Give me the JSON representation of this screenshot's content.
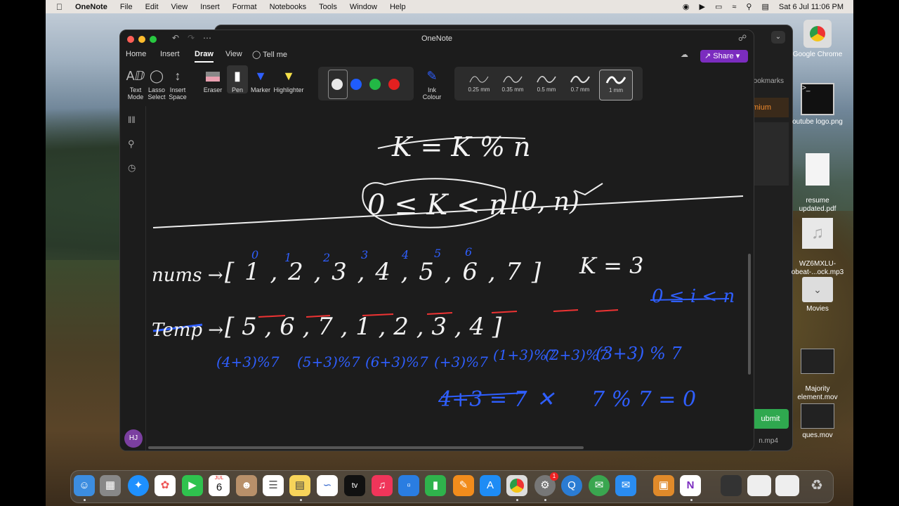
{
  "menubar": {
    "app": "OneNote",
    "items": [
      "File",
      "Edit",
      "View",
      "Insert",
      "Format",
      "Notebooks",
      "Tools",
      "Window",
      "Help"
    ],
    "datetime": "Sat 6 Jul  11:06 PM"
  },
  "window": {
    "title": "OneNote",
    "tabs": [
      "Home",
      "Insert",
      "Draw",
      "View"
    ],
    "tell_me": "Tell me",
    "share": "Share",
    "active_tab": "Draw"
  },
  "ribbon": {
    "text_mode": [
      "Text",
      "Mode"
    ],
    "lasso": [
      "Lasso",
      "Select"
    ],
    "insert_space": [
      "Insert",
      "Space"
    ],
    "eraser": "Eraser",
    "pen": "Pen",
    "marker": "Marker",
    "highlighter": "Highlighter",
    "ink_colour": [
      "Ink",
      "Colour"
    ],
    "colors": [
      "#e8e8e8",
      "#1f5cff",
      "#22b845",
      "#e32020"
    ],
    "widths": [
      "0.25 mm",
      "0.35 mm",
      "0.5 mm",
      "0.7 mm",
      "1 mm"
    ],
    "selected_width": "1 mm"
  },
  "sidebar": {
    "avatar": "HJ"
  },
  "note": {
    "line1": "K = K % n",
    "line2": "0 ≤ K < n",
    "line2b": "[0, n)",
    "nums_label": "nums →",
    "nums": "[ 1 , 2 , 3 , 4 , 5 , 6 , 7 ]",
    "idx": [
      "0",
      "1",
      "2",
      "3",
      "4",
      "5",
      "6"
    ],
    "k": "K = 3",
    "range": "0 ≤ i < n",
    "temp_label": "Temp →",
    "temp": "[  5   ,  6   ,  7   ,  1   ,  2  ,  3  ,  4 ]",
    "mods": [
      "(4+3)%7",
      "(5+3)%7",
      "(6+3)%7",
      "(+3)%7",
      "(1+3)%7",
      "(2+3)%7",
      "(3+3) % 7"
    ],
    "calc1": "4+3 = 7",
    "calc2": "7 % 7 = 0"
  },
  "background_window": {
    "bookmarks": "ookmarks",
    "premium": "emium",
    "submit": "ubmit",
    "file": "n.mp4"
  },
  "desktop": [
    {
      "name": "Google Chrome"
    },
    {
      "name": "outube logo.png"
    },
    {
      "name": "resume\nupdated.pdf"
    },
    {
      "name": "WZ6MXLU-\nobeat-...ock.mp3"
    },
    {
      "name": "Movies"
    },
    {
      "name": "Majority\nelement.mov"
    },
    {
      "name": "ques.mov"
    }
  ],
  "dock": {
    "calendar_month": "JUL",
    "calendar_day": "6",
    "badge": "1"
  }
}
